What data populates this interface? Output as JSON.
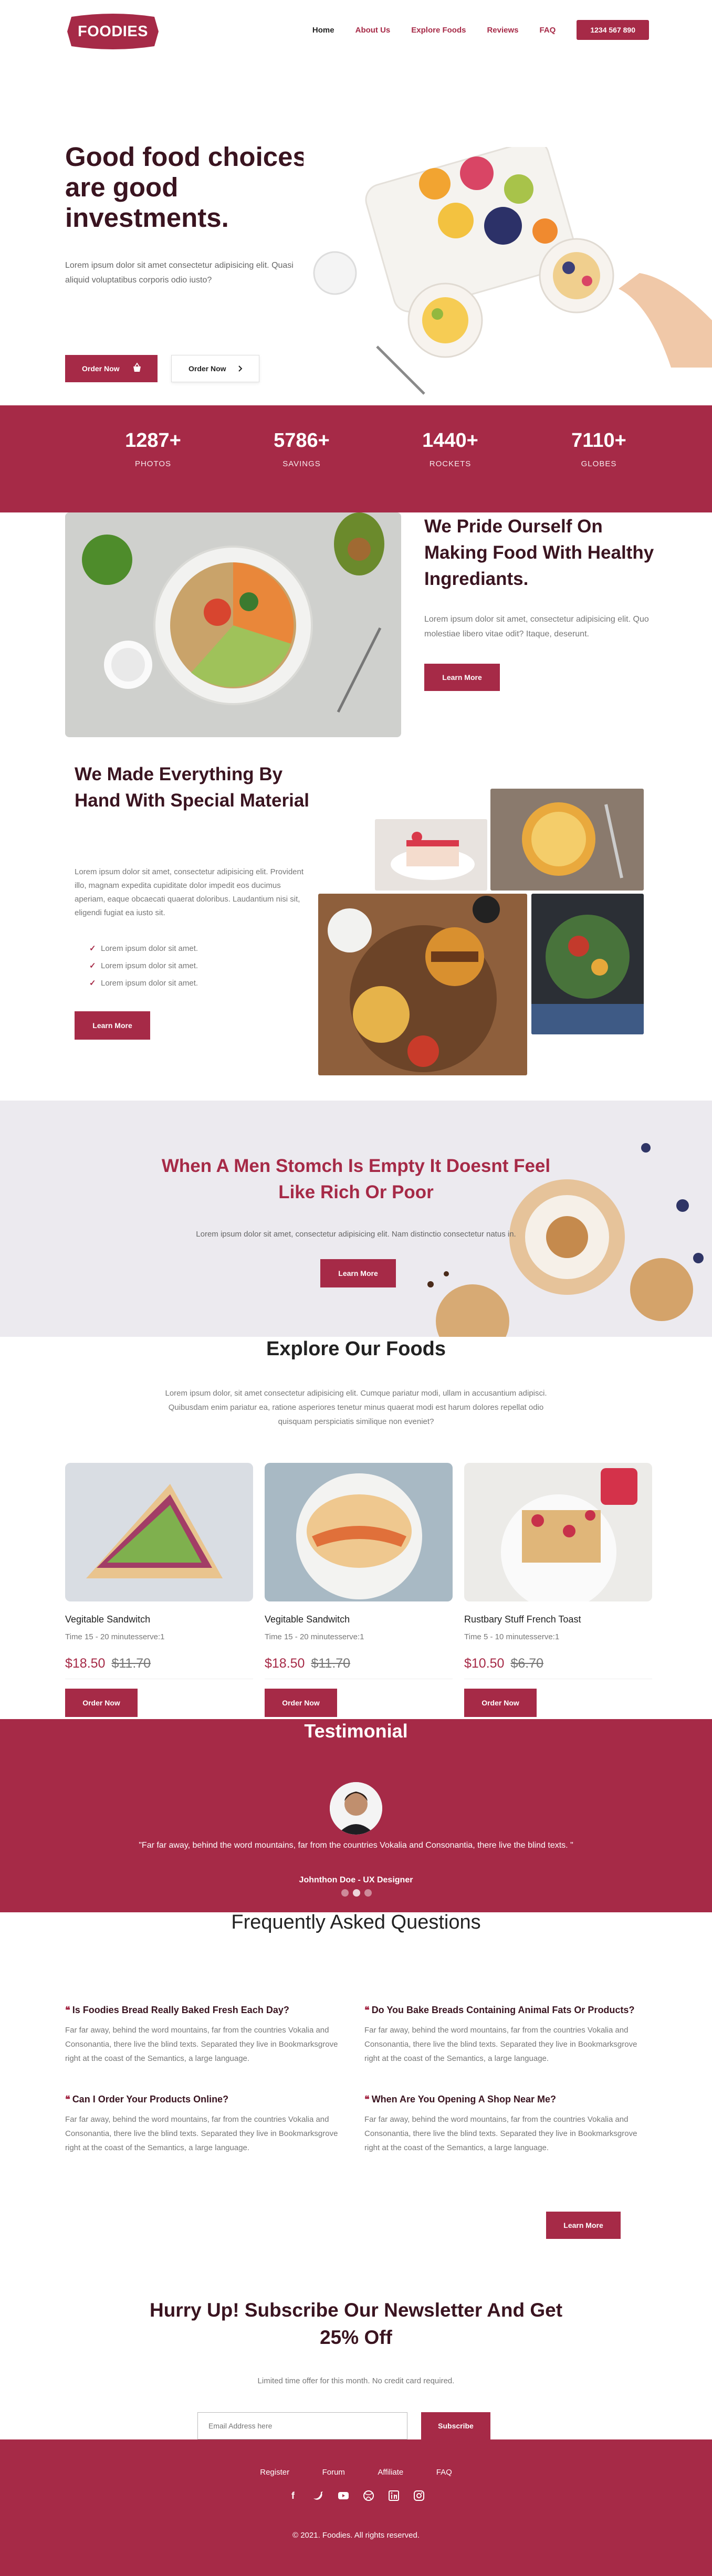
{
  "colors": {
    "brand": "#a62a47",
    "heading": "#3a1420",
    "muted": "#777777"
  },
  "nav": {
    "logo": "FOODIES",
    "links": [
      "Home",
      "About Us",
      "Explore Foods",
      "Reviews",
      "FAQ"
    ],
    "active": "Home",
    "phone": "1234 567 890"
  },
  "hero": {
    "title": "Good food choices are good investments.",
    "text": "Lorem ipsum dolor sit amet consectetur adipisicing elit. Quasi aliquid voluptatibus corporis odio iusto?",
    "order_primary": "Order Now",
    "order_secondary": "Order Now",
    "primary_icon": "basket-icon",
    "secondary_icon": "chevron-right-icon"
  },
  "stats": [
    {
      "value": "1287+",
      "label": "PHOTOS"
    },
    {
      "value": "5786+",
      "label": "SAVINGS"
    },
    {
      "value": "1440+",
      "label": "ROCKETS"
    },
    {
      "value": "7110+",
      "label": "GLOBES"
    }
  ],
  "pride": {
    "title": "We Pride Ourself On Making Food With Healthy Ingrediants.",
    "text": "Lorem ipsum dolor sit amet, consectetur adipisicing elit. Quo molestiae libero vitae odit? Itaque, deserunt.",
    "button": "Learn More"
  },
  "handmade": {
    "title": "We Made Everything By Hand With Special Material",
    "text": "Lorem ipsum dolor sit amet, consectetur adipisicing elit. Provident illo, magnam expedita cupiditate dolor impedit eos ducimus aperiam, eaque obcaecati quaerat doloribus. Laudantium nisi sit, eligendi fugiat ea iusto sit.",
    "checklist": [
      "Lorem ipsum dolor sit amet.",
      "Lorem ipsum dolor sit amet.",
      "Lorem ipsum dolor sit amet."
    ],
    "button": "Learn More"
  },
  "banner": {
    "title": "When A Men Stomch Is Empty It Doesnt Feel Like Rich Or Poor",
    "text": "Lorem ipsum dolor sit amet, consectetur adipisicing elit. Nam distinctio consectetur natus in.",
    "button": "Learn More"
  },
  "explore": {
    "title": "Explore Our Foods",
    "text": "Lorem ipsum dolor, sit amet consectetur adipisicing elit. Cumque pariatur modi, ullam in accusantium adipisci. Quibusdam enim pariatur ea, ratione asperiores tenetur minus quaerat modi est harum dolores repellat odio quisquam perspiciatis similique non eveniet?",
    "cards": [
      {
        "name": "Vegitable Sandwitch",
        "time": "Time 15 - 20 minutesserve:1",
        "price": "$18.50",
        "old_price": "$11.70",
        "button": "Order Now"
      },
      {
        "name": "Vegitable Sandwitch",
        "time": "Time 15 - 20 minutesserve:1",
        "price": "$18.50",
        "old_price": "$11.70",
        "button": "Order Now"
      },
      {
        "name": "Rustbary Stuff French Toast",
        "time": "Time 5 - 10 minutesserve:1",
        "price": "$10.50",
        "old_price": "$6.70",
        "button": "Order Now"
      }
    ]
  },
  "testimonial": {
    "title": "Testimonial",
    "quote": "\"Far far away, behind the word mountains, far from the countries Vokalia and Consonantia, there live the blind texts. \"",
    "author": "Johnthon Doe - UX Designer",
    "slides": 3,
    "active_slide": 2
  },
  "faq": {
    "title": "Frequently Asked Questions",
    "items": [
      {
        "q": "Is Foodies Bread Really Baked Fresh Each Day?",
        "a": "Far far away, behind the word mountains, far from the countries Vokalia and Consonantia, there live the blind texts. Separated they live in Bookmarksgrove right at the coast of the Semantics, a large language."
      },
      {
        "q": "Do You Bake Breads Containing Animal Fats Or Products?",
        "a": "Far far away, behind the word mountains, far from the countries Vokalia and Consonantia, there live the blind texts. Separated they live in Bookmarksgrove right at the coast of the Semantics, a large language."
      },
      {
        "q": "Can I Order Your Products Online?",
        "a": "Far far away, behind the word mountains, far from the countries Vokalia and Consonantia, there live the blind texts. Separated they live in Bookmarksgrove right at the coast of the Semantics, a large language."
      },
      {
        "q": "When Are You Opening A Shop Near Me?",
        "a": "Far far away, behind the word mountains, far from the countries Vokalia and Consonantia, there live the blind texts. Separated they live in Bookmarksgrove right at the coast of the Semantics, a large language."
      }
    ],
    "button": "Learn More"
  },
  "newsletter": {
    "title": "Hurry Up! Subscribe Our Newsletter And Get 25% Off",
    "text": "Limited time offer for this month. No credit card required.",
    "placeholder": "Email Address here",
    "button": "Subscribe"
  },
  "footer": {
    "links": [
      "Register",
      "Forum",
      "Affiliate",
      "FAQ"
    ],
    "socials": [
      "facebook-icon",
      "twitter-icon",
      "youtube-icon",
      "dribbble-icon",
      "linkedin-icon",
      "instagram-icon"
    ],
    "copyright": "© 2021. Foodies. All rights reserved."
  }
}
